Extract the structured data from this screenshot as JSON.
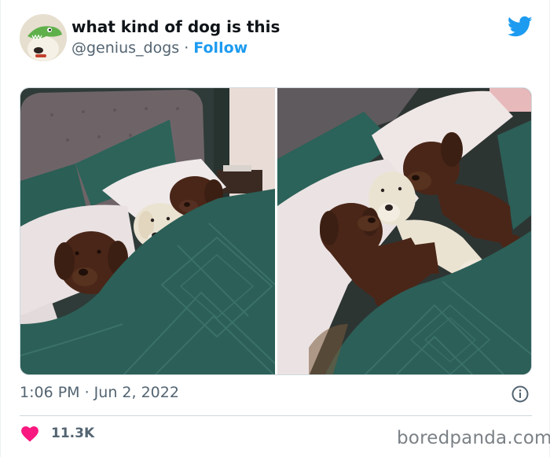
{
  "tweet": {
    "display_name": "what kind of dog is this",
    "handle": "@genius_dogs",
    "separator": "·",
    "follow_label": "Follow",
    "timestamp": "1:06 PM · Jun 2, 2022",
    "likes": "11.3K"
  },
  "icons": {
    "brand": "twitter-bird-icon",
    "info": "info-icon",
    "like": "heart-icon"
  },
  "colors": {
    "accent": "#1d9bf0",
    "like": "#f91880",
    "muted_text": "#536471",
    "quilt": "#2c5f57",
    "chocolate_dog": "#4a2618",
    "yellow_dog": "#ebe3d2"
  },
  "watermark": "boredpanda.com"
}
